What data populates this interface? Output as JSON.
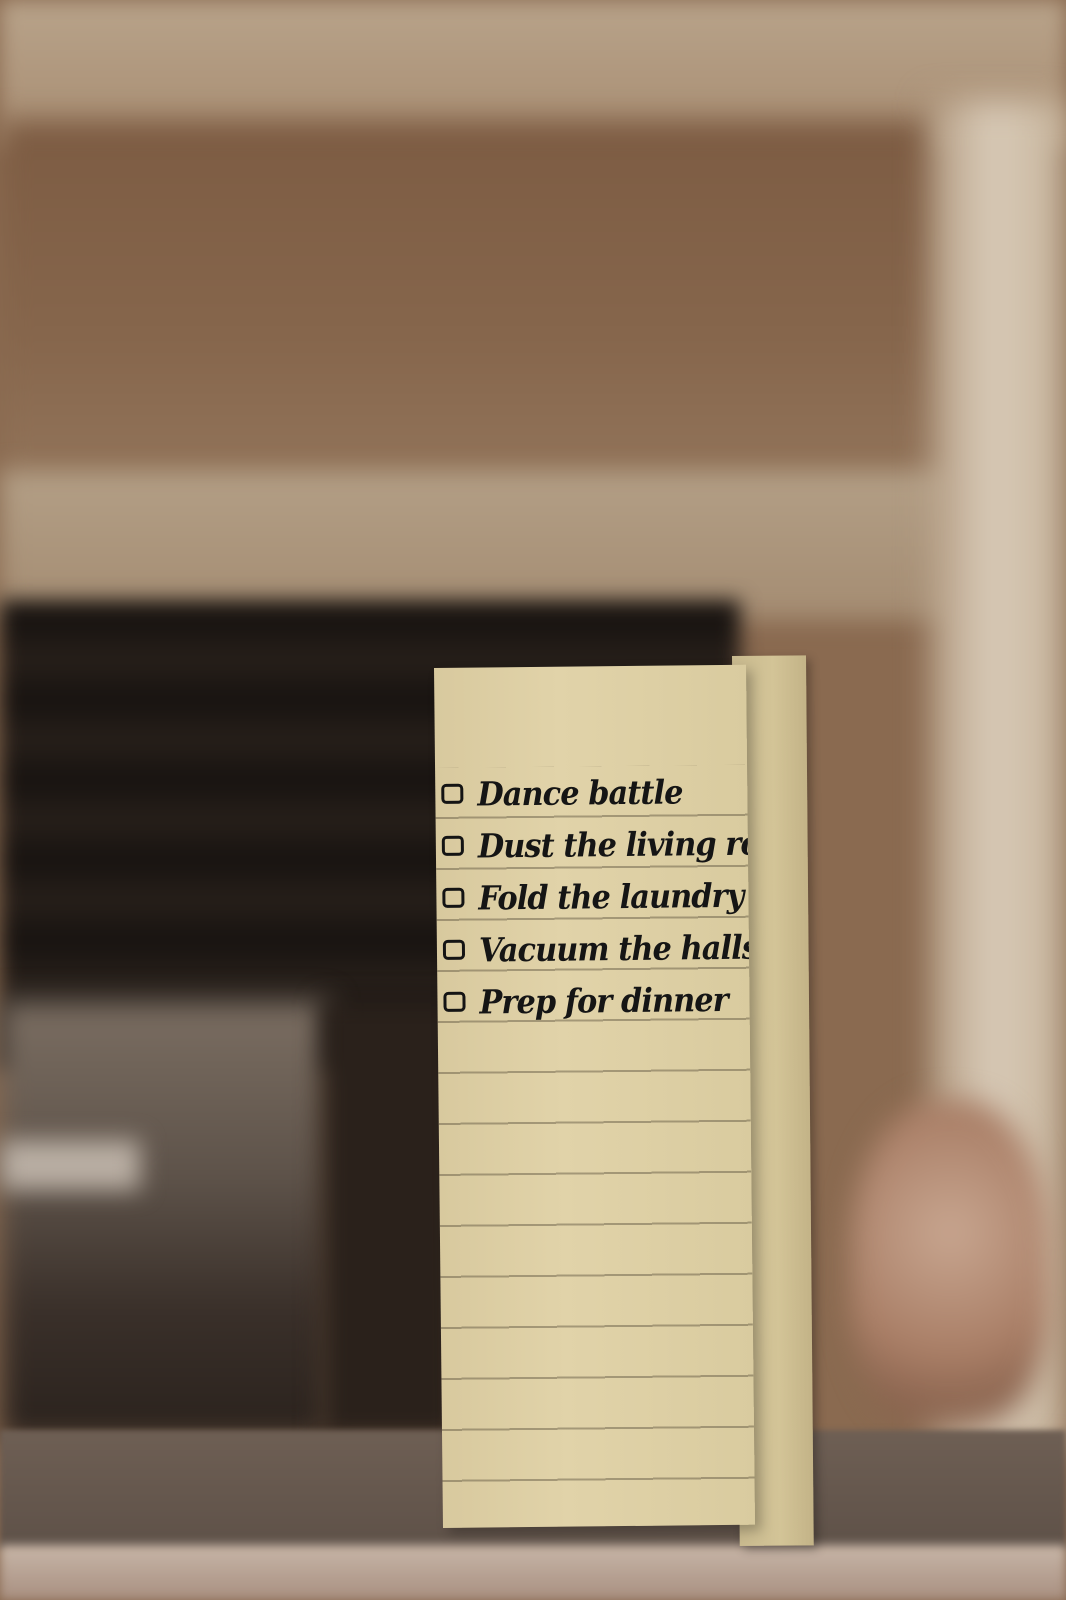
{
  "note": {
    "items": [
      {
        "label": "Dance battle",
        "checked": false
      },
      {
        "label": "Dust the living room",
        "checked": false
      },
      {
        "label": "Fold the laundry",
        "checked": false
      },
      {
        "label": "Vacuum the halls",
        "checked": false
      },
      {
        "label": "Prep for dinner",
        "checked": false
      }
    ]
  },
  "colors": {
    "paper": "#e1d3a9",
    "ink": "#151515",
    "wall": "#86664c",
    "fireplace": "#1a1512"
  }
}
